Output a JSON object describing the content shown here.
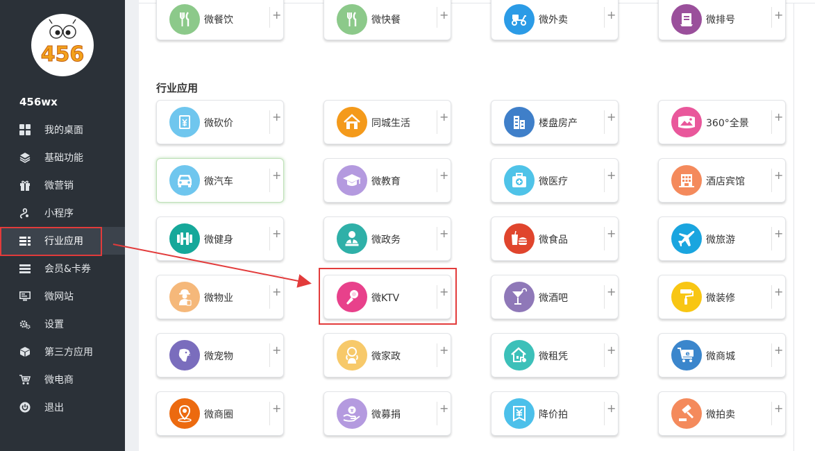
{
  "sidebar": {
    "user_name": "456wx",
    "logo_text": "456",
    "items": [
      {
        "label": "我的桌面",
        "icon": "grid-icon"
      },
      {
        "label": "基础功能",
        "icon": "layers-icon"
      },
      {
        "label": "微营销",
        "icon": "gift-icon"
      },
      {
        "label": "小程序",
        "icon": "mini-program-icon"
      },
      {
        "label": "行业应用",
        "icon": "list-icon",
        "active": true
      },
      {
        "label": "会员&卡券",
        "icon": "card-icon"
      },
      {
        "label": "微网站",
        "icon": "monitor-icon"
      },
      {
        "label": "设置",
        "icon": "gear-icon"
      },
      {
        "label": "第三方应用",
        "icon": "cube-icon"
      },
      {
        "label": "微电商",
        "icon": "cart-icon"
      },
      {
        "label": "退出",
        "icon": "power-icon"
      }
    ]
  },
  "top_row": [
    {
      "label": "微餐饮",
      "icon": "fork-knife-icon",
      "color": "#8cc98a"
    },
    {
      "label": "微快餐",
      "icon": "fork-knife-icon",
      "color": "#8cc98a"
    },
    {
      "label": "微外卖",
      "icon": "scooter-icon",
      "color": "#2b9be6"
    },
    {
      "label": "微排号",
      "icon": "queue-ticket-icon",
      "color": "#9a4f9b"
    }
  ],
  "section": {
    "title": "行业应用",
    "plus": "+",
    "apps": [
      {
        "label": "微砍价",
        "icon": "price-tag-icon",
        "color": "#6fc6ee"
      },
      {
        "label": "同城生活",
        "icon": "house-icon",
        "color": "#f49a1b"
      },
      {
        "label": "楼盘房产",
        "icon": "buildings-icon",
        "color": "#3f7fc9"
      },
      {
        "label": "360°全景",
        "icon": "panorama-icon",
        "color": "#e9579b"
      },
      {
        "label": "微汽车",
        "icon": "car-icon",
        "color": "#6fc6ee"
      },
      {
        "label": "微教育",
        "icon": "graduation-cap-icon",
        "color": "#b49adf"
      },
      {
        "label": "微医疗",
        "icon": "medical-kit-icon",
        "color": "#4fc3e8"
      },
      {
        "label": "酒店宾馆",
        "icon": "hotel-icon",
        "color": "#f48a5c"
      },
      {
        "label": "微健身",
        "icon": "dumbbell-icon",
        "color": "#16a89a"
      },
      {
        "label": "微政务",
        "icon": "official-icon",
        "color": "#2fb0a8"
      },
      {
        "label": "微食品",
        "icon": "food-icon",
        "color": "#e0452d"
      },
      {
        "label": "微旅游",
        "icon": "airplane-icon",
        "color": "#1aa5df"
      },
      {
        "label": "微物业",
        "icon": "worker-icon",
        "color": "#f5b87a"
      },
      {
        "label": "微KTV",
        "icon": "microphone-icon",
        "color": "#e8418b"
      },
      {
        "label": "微酒吧",
        "icon": "cocktail-icon",
        "color": "#8f78b8"
      },
      {
        "label": "微装修",
        "icon": "paint-roller-icon",
        "color": "#f8c613"
      },
      {
        "label": "微宠物",
        "icon": "dog-icon",
        "color": "#7a6dbd"
      },
      {
        "label": "微家政",
        "icon": "housekeeper-icon",
        "color": "#f7c96a"
      },
      {
        "label": "微租凭",
        "icon": "house-key-icon",
        "color": "#3cc0b9"
      },
      {
        "label": "微商城",
        "icon": "shopping-cart-icon",
        "color": "#3b86cc"
      },
      {
        "label": "微商圈",
        "icon": "location-pin-icon",
        "color": "#ec6a0f"
      },
      {
        "label": "微募捐",
        "icon": "donate-icon",
        "color": "#b49adf"
      },
      {
        "label": "降价拍",
        "icon": "discount-icon",
        "color": "#4cc0ea"
      },
      {
        "label": "微拍卖",
        "icon": "auction-hammer-icon",
        "color": "#f48a5c"
      }
    ]
  }
}
